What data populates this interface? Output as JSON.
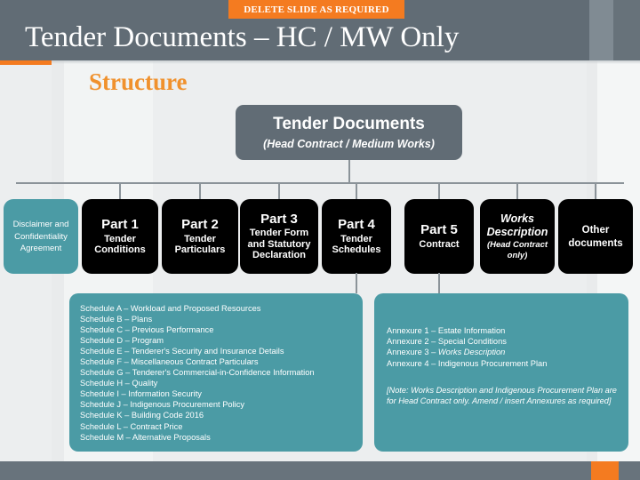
{
  "header": {
    "banner_label": "DELETE SLIDE AS REQUIRED",
    "title": "Tender Documents – HC / MW Only",
    "bg_color": "#616c75",
    "accent_color": "#f47b20"
  },
  "section": {
    "heading": "Structure",
    "heading_color": "#f0912d"
  },
  "root": {
    "title": "Tender Documents",
    "subtitle": "(Head Contract / Medium Works)"
  },
  "nodes": [
    {
      "name": "disclaimer",
      "main": "",
      "sub": "Disclaimer and Confidentiality Agreement",
      "color": "#4b9ba5",
      "style": "teal"
    },
    {
      "name": "part-1",
      "main": "Part 1",
      "sub": "Tender Conditions",
      "color": "#000000",
      "style": "black"
    },
    {
      "name": "part-2",
      "main": "Part 2",
      "sub": "Tender Particulars",
      "color": "#000000",
      "style": "black"
    },
    {
      "name": "part-3",
      "main": "Part 3",
      "sub": "Tender Form and Statutory Declaration",
      "color": "#000000",
      "style": "black"
    },
    {
      "name": "part-4",
      "main": "Part 4",
      "sub": "Tender Schedules",
      "color": "#000000",
      "style": "black"
    },
    {
      "name": "part-5",
      "main": "Part 5",
      "sub": "Contract",
      "color": "#000000",
      "style": "black"
    },
    {
      "name": "works-description",
      "main": "Works Description",
      "sub": "(Head Contract only)",
      "color": "#000000",
      "style": "black-italic"
    },
    {
      "name": "other-documents",
      "main": "",
      "sub": "Other documents",
      "color": "#000000",
      "style": "black-plain"
    }
  ],
  "schedules": {
    "items": [
      "Schedule A – Workload and Proposed Resources",
      "Schedule B – Plans",
      "Schedule C – Previous Performance",
      "Schedule D – Program",
      "Schedule E – Tenderer's Security and Insurance Details",
      "Schedule F – Miscellaneous Contract Particulars",
      "Schedule G – Tenderer's Commercial-in-Confidence  Information",
      "Schedule H –  Quality",
      "Schedule I  –  Information Security",
      "Schedule J –  Indigenous Procurement Policy",
      "Schedule K – Building Code 2016",
      "Schedule L – Contract  Price",
      "Schedule M – Alternative Proposals"
    ]
  },
  "annexures": {
    "items": [
      {
        "prefix": "Annexure 1 – Estate Information",
        "italic": ""
      },
      {
        "prefix": "Annexure 2 – Special Conditions",
        "italic": ""
      },
      {
        "prefix": "Annexure 3 – ",
        "italic": "Works Description"
      },
      {
        "prefix": "Annexure  4  –  Indigenous Procurement Plan",
        "italic": ""
      }
    ],
    "note": "[Note: Works Description and Indigenous Procurement Plan are for Head Contract only. Amend / insert Annexures as required]"
  },
  "footer": {
    "bar_color": "#68737c",
    "accent_color": "#f47b20"
  }
}
